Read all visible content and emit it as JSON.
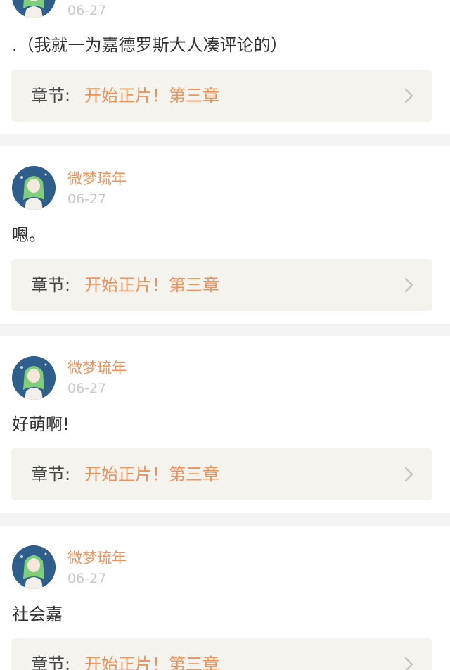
{
  "comments": [
    {
      "username": "",
      "date": "06-27",
      "text": ".（我就一为嘉德罗斯大人凑评论的）",
      "chapter_label": "章节:",
      "chapter_title": "开始正片！第三章"
    },
    {
      "username": "微梦琉年",
      "date": "06-27",
      "text": "嗯。",
      "chapter_label": "章节:",
      "chapter_title": "开始正片！第三章"
    },
    {
      "username": "微梦琉年",
      "date": "06-27",
      "text": "好萌啊!",
      "chapter_label": "章节:",
      "chapter_title": "开始正片！第三章"
    },
    {
      "username": "微梦琉年",
      "date": "06-27",
      "text": "社会嘉",
      "chapter_label": "章节:",
      "chapter_title": "开始正片！第三章"
    }
  ],
  "colors": {
    "accent": "#f0925b",
    "card_bg": "#f4f3ed",
    "separator": "#f4f4f4",
    "date": "#c8c8c8"
  },
  "icons": [
    "avatar",
    "chevron-right-icon"
  ]
}
